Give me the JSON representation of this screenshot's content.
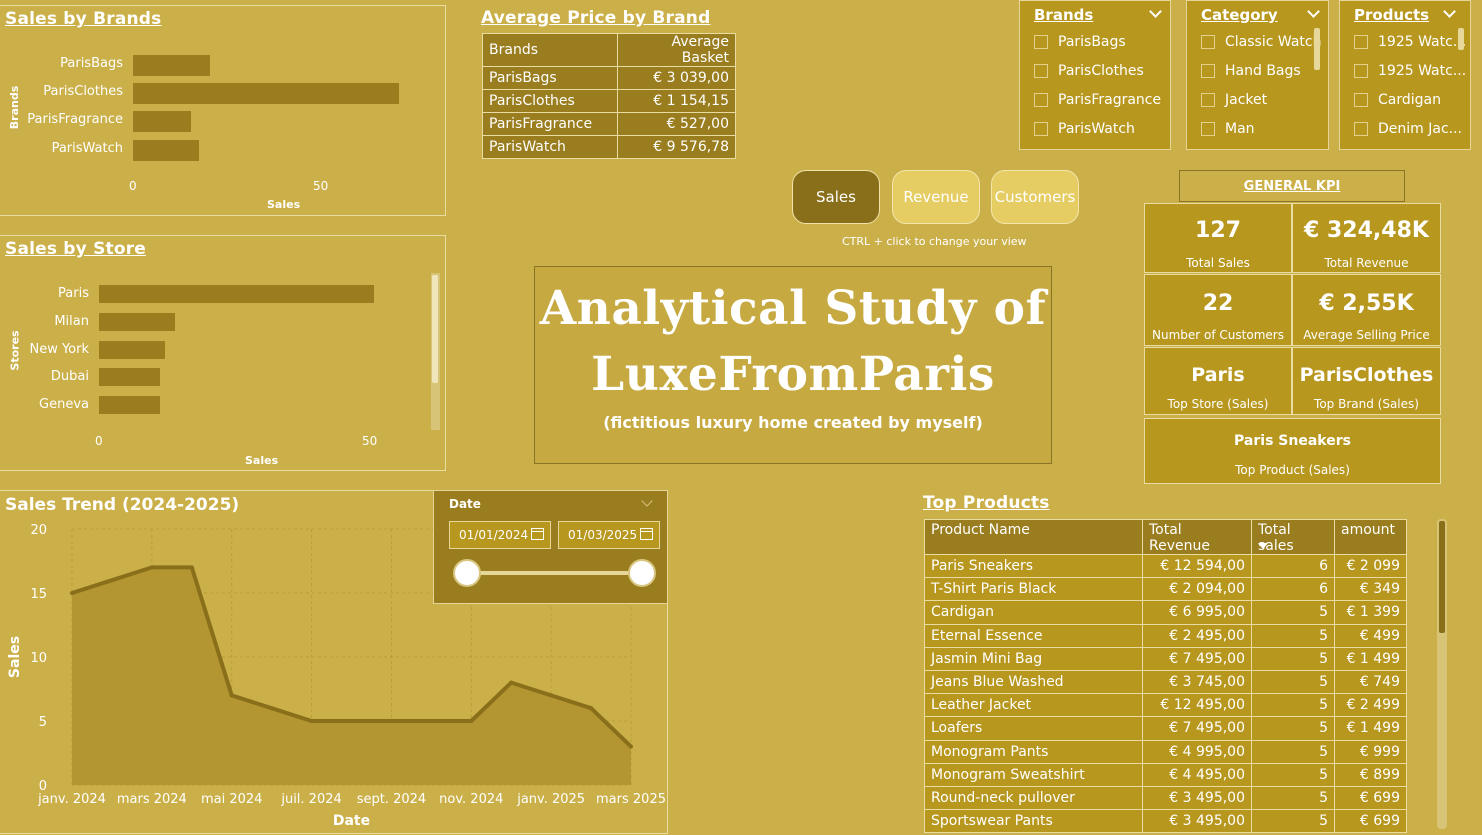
{
  "colors": {
    "background": "#cbb04a",
    "bar": "#9a7d1e",
    "panel": "#b8971f",
    "accent": "#8a6f1a",
    "light_button": "#e6cd63"
  },
  "sales_by_brands": {
    "title": "Sales by Brands",
    "y_axis_label": "Brands",
    "x_axis_label": "Sales",
    "ticks": [
      "0",
      "50"
    ]
  },
  "sales_by_store": {
    "title": "Sales by Store",
    "y_axis_label": "Stores",
    "x_axis_label": "Sales",
    "ticks": [
      "0",
      "50"
    ]
  },
  "avg_price": {
    "title": "Average Price by Brand",
    "headers": [
      "Brands",
      "Average Basket"
    ],
    "rows": [
      [
        "ParisBags",
        "€ 3 039,00"
      ],
      [
        "ParisClothes",
        "€ 1 154,15"
      ],
      [
        "ParisFragrance",
        "€ 527,00"
      ],
      [
        "ParisWatch",
        "€ 9 576,78"
      ]
    ]
  },
  "slicers": {
    "brands": {
      "header": "Brands",
      "items": [
        "ParisBags",
        "ParisClothes",
        "ParisFragrance",
        "ParisWatch"
      ]
    },
    "category": {
      "header": "Category",
      "items": [
        "Classic Watch",
        "Hand Bags",
        "Jacket",
        "Man"
      ]
    },
    "products": {
      "header": "Products",
      "items": [
        "1925 Watc...",
        "1925 Watc...",
        "Cardigan",
        "Denim Jac..."
      ]
    }
  },
  "nav": {
    "sales": "Sales",
    "revenue": "Revenue",
    "customers": "Customers",
    "hint": "CTRL + click to change your view"
  },
  "hero": {
    "title_line1": "Analytical Study of",
    "title_line2": "LuxeFromParis",
    "subtitle": "(fictitious luxury home created by myself)"
  },
  "kpi": {
    "header": "GENERAL KPI",
    "total_sales": {
      "value": "127",
      "label": "Total Sales"
    },
    "total_revenue": {
      "value": "€ 324,48K",
      "label": "Total Revenue"
    },
    "customers": {
      "value": "22",
      "label": "Number of Customers"
    },
    "avg_price": {
      "value": "€ 2,55K",
      "label": "Average Selling Price"
    },
    "top_store": {
      "value": "Paris",
      "label": "Top Store (Sales)"
    },
    "top_brand": {
      "value": "ParisClothes",
      "label": "Top Brand (Sales)"
    },
    "top_product": {
      "value": "Paris Sneakers",
      "label": "Top Product (Sales)"
    }
  },
  "date_slicer": {
    "label": "Date",
    "start": "01/01/2024",
    "end": "01/03/2025"
  },
  "top_products": {
    "title": "Top Products",
    "headers": [
      "Product Name",
      "Total Revenue",
      "Total sales",
      "amount"
    ],
    "rows": [
      [
        "Paris Sneakers",
        "€ 12 594,00",
        "6",
        "€ 2 099"
      ],
      [
        "T-Shirt Paris Black",
        "€ 2 094,00",
        "6",
        "€ 349"
      ],
      [
        "Cardigan",
        "€ 6 995,00",
        "5",
        "€ 1 399"
      ],
      [
        "Eternal Essence",
        "€ 2 495,00",
        "5",
        "€ 499"
      ],
      [
        "Jasmin Mini Bag",
        "€ 7 495,00",
        "5",
        "€ 1 499"
      ],
      [
        "Jeans Blue Washed",
        "€ 3 745,00",
        "5",
        "€ 749"
      ],
      [
        "Leather Jacket",
        "€ 12 495,00",
        "5",
        "€ 2 499"
      ],
      [
        "Loafers",
        "€ 7 495,00",
        "5",
        "€ 1 499"
      ],
      [
        "Monogram Pants",
        "€ 4 995,00",
        "5",
        "€ 999"
      ],
      [
        "Monogram Sweatshirt",
        "€ 4 495,00",
        "5",
        "€ 899"
      ],
      [
        "Round-neck pullover",
        "€ 3 495,00",
        "5",
        "€ 699"
      ],
      [
        "Sportswear Pants",
        "€ 3 495,00",
        "5",
        "€ 699"
      ]
    ]
  },
  "chart_data": [
    {
      "type": "bar",
      "title": "Sales by Brands",
      "xlabel": "Sales",
      "ylabel": "Brands",
      "categories": [
        "ParisBags",
        "ParisClothes",
        "ParisFragrance",
        "ParisWatch"
      ],
      "values": [
        21,
        73,
        16,
        18
      ],
      "xlim": [
        0,
        80
      ]
    },
    {
      "type": "bar",
      "title": "Sales by Store",
      "xlabel": "Sales",
      "ylabel": "Stores",
      "categories": [
        "Paris",
        "Milan",
        "New York",
        "Dubai",
        "Geneva"
      ],
      "values": [
        54,
        15,
        13,
        12,
        12
      ],
      "xlim": [
        0,
        62
      ]
    },
    {
      "type": "area",
      "title": "Sales Trend (2024-2025)",
      "xlabel": "Date",
      "ylabel": "Sales",
      "x": [
        "janv. 2024",
        "févr. 2024",
        "mars 2024",
        "avr. 2024",
        "mai 2024",
        "juin 2024",
        "juil. 2024",
        "août 2024",
        "sept. 2024",
        "oct. 2024",
        "nov. 2024",
        "déc. 2024",
        "janv. 2025",
        "févr. 2025",
        "mars 2025"
      ],
      "values": [
        15,
        16,
        17,
        17,
        7,
        6,
        5,
        5,
        5,
        5,
        5,
        8,
        7,
        6,
        3
      ],
      "x_tick_labels": [
        "janv. 2024",
        "mars 2024",
        "mai 2024",
        "juil. 2024",
        "sept. 2024",
        "nov. 2024",
        "janv. 2025",
        "mars 2025"
      ],
      "y_ticks": [
        "0",
        "5",
        "10",
        "15",
        "20"
      ],
      "ylim": [
        0,
        20
      ],
      "grid": true
    }
  ]
}
